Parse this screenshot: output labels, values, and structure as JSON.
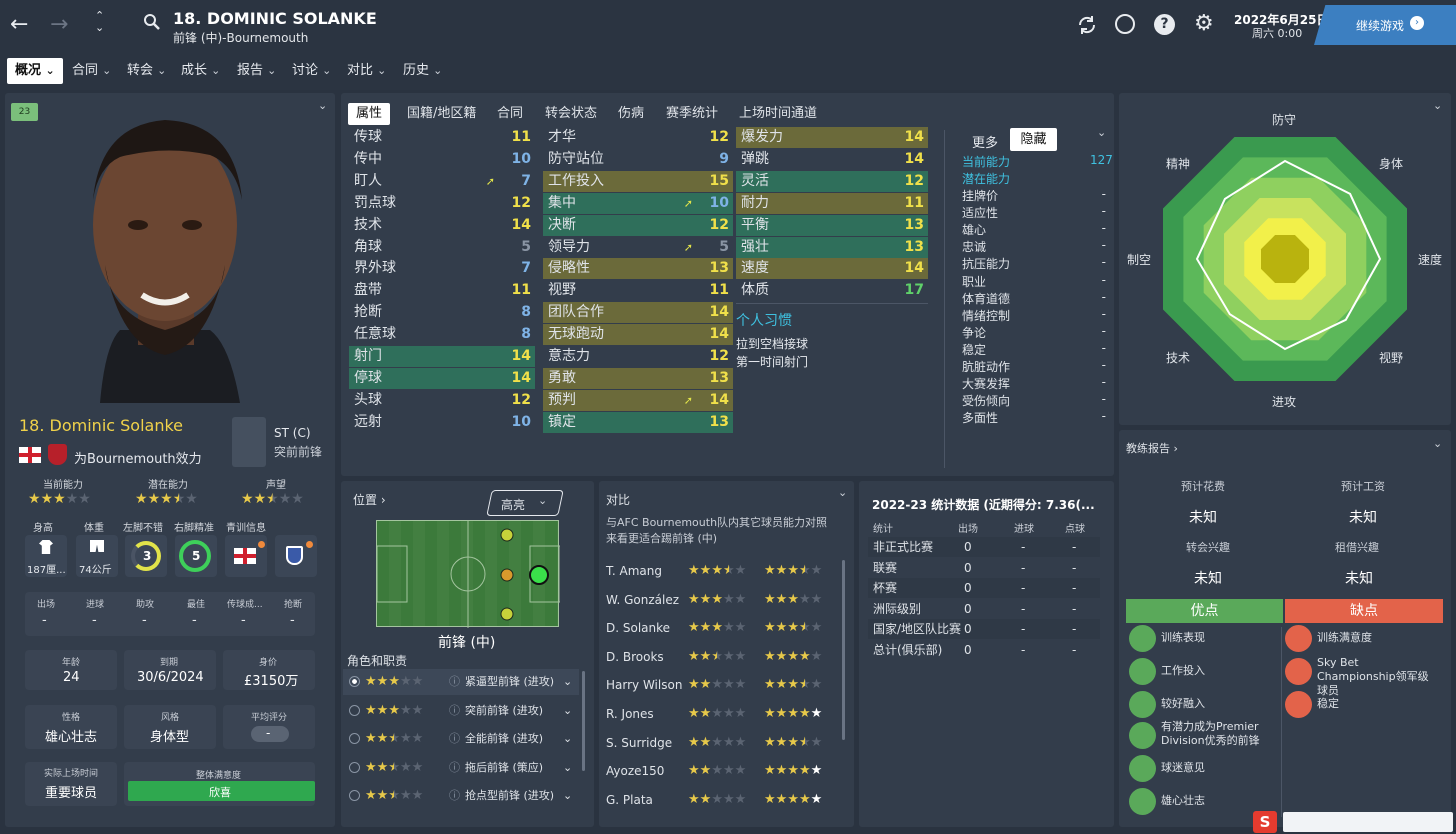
{
  "header": {
    "player_title": "18. DOMINIC SOLANKE",
    "player_sub": "前锋 (中)-Bournemouth",
    "date": "2022年6月25日",
    "weekday_time": "周六 0:00",
    "continue": "继续游戏"
  },
  "nav": [
    "概况",
    "合同",
    "转会",
    "成长",
    "报告",
    "讨论",
    "对比",
    "历史"
  ],
  "left": {
    "age_badge": "23岁...",
    "name": "18. Dominic Solanke",
    "club_line": "为Bournemouth效力",
    "position_code": "ST (C)",
    "position_role": "突前前锋",
    "ability_labels": [
      "当前能力",
      "潜在能力",
      "声望"
    ],
    "ability_stars": [
      3,
      3.5,
      2.5
    ],
    "attr_labels": [
      "身高",
      "体重",
      "左脚不错",
      "右脚精准",
      "青训信息"
    ],
    "height": "187厘...",
    "weight": "74公斤",
    "left_foot": "3",
    "right_foot": "5",
    "stat_labels": [
      "出场",
      "进球",
      "助攻",
      "最佳",
      "传球成...",
      "抢断"
    ],
    "stat_values": [
      "-",
      "-",
      "-",
      "-",
      "-",
      "-"
    ],
    "info": [
      {
        "label": "年龄",
        "value": "24"
      },
      {
        "label": "到期",
        "value": "30/6/2024"
      },
      {
        "label": "身价",
        "value": "£3150万"
      }
    ],
    "personality_label": "性格",
    "personality": "雄心壮志",
    "style_label": "风格",
    "style": "身体型",
    "avg_rating_label": "平均评分",
    "avg_rating": "-",
    "playing_time_label": "实际上场时间",
    "playing_time": "重要球员",
    "happiness_label": "整体满意度",
    "happiness": "欣喜"
  },
  "tabs": [
    "属性",
    "国籍/地区籍",
    "合同",
    "转会状态",
    "伤病",
    "赛季统计",
    "上场时间通道"
  ],
  "attributes": {
    "technical": [
      {
        "name": "传球",
        "value": "11",
        "color": "#f0e04a",
        "hl": ""
      },
      {
        "name": "传中",
        "value": "10",
        "color": "#7fb3e6",
        "hl": ""
      },
      {
        "name": "盯人",
        "value": "7",
        "color": "#7fb3e6",
        "hl": "",
        "arrow": true
      },
      {
        "name": "罚点球",
        "value": "12",
        "color": "#f0e04a",
        "hl": ""
      },
      {
        "name": "技术",
        "value": "14",
        "color": "#f0e04a",
        "hl": ""
      },
      {
        "name": "角球",
        "value": "5",
        "color": "#8a95a4",
        "hl": ""
      },
      {
        "name": "界外球",
        "value": "7",
        "color": "#7fb3e6",
        "hl": ""
      },
      {
        "name": "盘带",
        "value": "11",
        "color": "#f0e04a",
        "hl": ""
      },
      {
        "name": "抢断",
        "value": "8",
        "color": "#7fb3e6",
        "hl": ""
      },
      {
        "name": "任意球",
        "value": "8",
        "color": "#7fb3e6",
        "hl": ""
      },
      {
        "name": "射门",
        "value": "14",
        "color": "#f0e04a",
        "hl": "green"
      },
      {
        "name": "停球",
        "value": "14",
        "color": "#f0e04a",
        "hl": "green"
      },
      {
        "name": "头球",
        "value": "12",
        "color": "#f0e04a",
        "hl": ""
      },
      {
        "name": "远射",
        "value": "10",
        "color": "#7fb3e6",
        "hl": ""
      }
    ],
    "mental": [
      {
        "name": "才华",
        "value": "12",
        "color": "#f0e04a",
        "hl": ""
      },
      {
        "name": "防守站位",
        "value": "9",
        "color": "#7fb3e6",
        "hl": ""
      },
      {
        "name": "工作投入",
        "value": "15",
        "color": "#f0e04a",
        "hl": "yellow"
      },
      {
        "name": "集中",
        "value": "10",
        "color": "#7fb3e6",
        "hl": "green",
        "arrow": true
      },
      {
        "name": "决断",
        "value": "12",
        "color": "#f0e04a",
        "hl": "green"
      },
      {
        "name": "领导力",
        "value": "5",
        "color": "#8a95a4",
        "hl": "",
        "arrow": true
      },
      {
        "name": "侵略性",
        "value": "13",
        "color": "#f0e04a",
        "hl": "yellow"
      },
      {
        "name": "视野",
        "value": "11",
        "color": "#f0e04a",
        "hl": ""
      },
      {
        "name": "团队合作",
        "value": "14",
        "color": "#f0e04a",
        "hl": "yellow"
      },
      {
        "name": "无球跑动",
        "value": "14",
        "color": "#f0e04a",
        "hl": "yellow"
      },
      {
        "name": "意志力",
        "value": "12",
        "color": "#f0e04a",
        "hl": ""
      },
      {
        "name": "勇敢",
        "value": "13",
        "color": "#f0e04a",
        "hl": "yellow"
      },
      {
        "name": "预判",
        "value": "14",
        "color": "#f0e04a",
        "hl": "yellow",
        "arrow": true
      },
      {
        "name": "镇定",
        "value": "13",
        "color": "#f0e04a",
        "hl": "green"
      }
    ],
    "physical": [
      {
        "name": "爆发力",
        "value": "14",
        "color": "#f0e04a",
        "hl": "yellow"
      },
      {
        "name": "弹跳",
        "value": "14",
        "color": "#f0e04a",
        "hl": ""
      },
      {
        "name": "灵活",
        "value": "12",
        "color": "#f0e04a",
        "hl": "green"
      },
      {
        "name": "耐力",
        "value": "11",
        "color": "#f0e04a",
        "hl": "yellow"
      },
      {
        "name": "平衡",
        "value": "13",
        "color": "#f0e04a",
        "hl": "green"
      },
      {
        "name": "强壮",
        "value": "13",
        "color": "#f0e04a",
        "hl": "green"
      },
      {
        "name": "速度",
        "value": "14",
        "color": "#f0e04a",
        "hl": "yellow"
      },
      {
        "name": "体质",
        "value": "17",
        "color": "#5fd16a",
        "hl": ""
      }
    ]
  },
  "habits_title": "个人习惯",
  "habits": [
    "拉到空档接球",
    "第一时间射门"
  ],
  "hidden": {
    "btn_more": "更多",
    "btn_hidden": "隐藏",
    "ca_label": "当前能力",
    "ca_value": "127",
    "pa_label": "潜在能力",
    "rows": [
      "挂牌价",
      "适应性",
      "雄心",
      "忠诚",
      "抗压能力",
      "职业",
      "体育道德",
      "情绪控制",
      "争论",
      "稳定",
      "肮脏动作",
      "大赛发挥",
      "受伤倾向",
      "多面性"
    ],
    "row_value": "-"
  },
  "radar": {
    "labels": [
      "防守",
      "身体",
      "速度",
      "视野",
      "进攻",
      "技术",
      "制空",
      "精神"
    ]
  },
  "position_panel": {
    "title": "位置",
    "highlight": "高亮",
    "position_name": "前锋 (中)",
    "roles_title": "角色和职责",
    "roles": [
      {
        "name": "紧逼型前锋 (进攻)",
        "stars": 3
      },
      {
        "name": "突前前锋 (进攻)",
        "stars": 3
      },
      {
        "name": "全能前锋 (进攻)",
        "stars": 2.5
      },
      {
        "name": "拖后前锋 (策应)",
        "stars": 2.5
      },
      {
        "name": "抢点型前锋 (进攻)",
        "stars": 2.5
      }
    ]
  },
  "compare": {
    "title": "对比",
    "desc": "与AFC Bournemouth队内其它球员能力对照来看更适合踢前锋 (中)",
    "players": [
      {
        "name": "T. Amang",
        "a": 3.5,
        "b": 3.5
      },
      {
        "name": "W. González",
        "a": 3,
        "b": 3
      },
      {
        "name": "D. Solanke",
        "a": 3,
        "b": 3.5
      },
      {
        "name": "D. Brooks",
        "a": 2.5,
        "b": 4
      },
      {
        "name": "Harry Wilson",
        "a": 2,
        "b": 3.5
      },
      {
        "name": "R. Jones",
        "a": 2,
        "b": 4,
        "b_white": true
      },
      {
        "name": "S. Surridge",
        "a": 2,
        "b": 3.5
      },
      {
        "name": "Ayoze150",
        "a": 2,
        "b": 4,
        "b_white": true
      },
      {
        "name": "G. Plata",
        "a": 2,
        "b": 4,
        "b_white": true
      }
    ]
  },
  "season": {
    "title": "2022-23 统计数据 (近期得分: 7.36(...",
    "headers": [
      "统计",
      "出场",
      "进球",
      "点球"
    ],
    "rows": [
      {
        "name": "非正式比赛",
        "apps": "0",
        "goals": "-",
        "pens": "-"
      },
      {
        "name": "联赛",
        "apps": "0",
        "goals": "-",
        "pens": "-"
      },
      {
        "name": "杯赛",
        "apps": "0",
        "goals": "-",
        "pens": "-"
      },
      {
        "name": "洲际级别",
        "apps": "0",
        "goals": "-",
        "pens": "-"
      },
      {
        "name": "国家/地区队比赛",
        "apps": "0",
        "goals": "-",
        "pens": "-"
      },
      {
        "name": "总计(俱乐部)",
        "apps": "0",
        "goals": "-",
        "pens": "-"
      }
    ]
  },
  "report": {
    "title": "教练报告",
    "fee_label": "预计花费",
    "fee": "未知",
    "wage_label": "预计工资",
    "wage": "未知",
    "transfer_label": "转会兴趣",
    "transfer": "未知",
    "loan_label": "租借兴趣",
    "loan": "未知",
    "pros_title": "优点",
    "cons_title": "缺点",
    "pros": [
      "训练表现",
      "工作投入",
      "较好融入",
      "有潜力成为Premier Division优秀的前锋",
      "球迷意见",
      "雄心壮志"
    ],
    "cons": [
      "训练满意度",
      "Sky Bet Championship领军级球员",
      "稳定"
    ]
  },
  "colors": {
    "accent": "#2f6f5b",
    "pro": "#5aa95a",
    "con": "#e3634a",
    "continue": "#3c7fc1"
  }
}
